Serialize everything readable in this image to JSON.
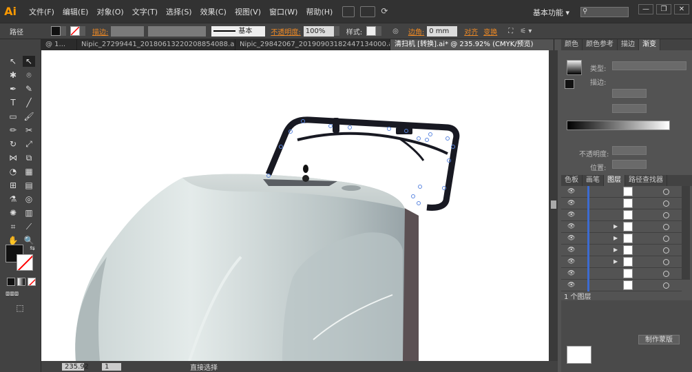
{
  "app": {
    "logo": "Ai"
  },
  "menu": [
    "文件(F)",
    "编辑(E)",
    "对象(O)",
    "文字(T)",
    "选择(S)",
    "效果(C)",
    "视图(V)",
    "窗口(W)",
    "帮助(H)"
  ],
  "workspace_label": "基本功能",
  "window_buttons": [
    "—",
    "❐",
    "✕"
  ],
  "control": {
    "path_label": "路径",
    "stroke_label": "描边:",
    "stroke_style": "基本",
    "opacity_label": "不透明度:",
    "opacity_value": "100%",
    "style_label": "样式:",
    "corner_label": "边角:",
    "corner_value": "0 mm",
    "align_label": "对齐",
    "transform_label": "变换"
  },
  "tabs": [
    {
      "label": "@ 1..."
    },
    {
      "label": "Nipic_27299441_20180613220208854088.ai*"
    },
    {
      "label": "Nipic_29842067_20190903182447134000.ai*"
    },
    {
      "label": "清扫机 [转换].ai* @ 235.92% (CMYK/预览)",
      "active": true
    }
  ],
  "panels": {
    "top_tabs": [
      "颜色",
      "颜色参考",
      "描边",
      "渐变"
    ],
    "gradient": {
      "type_label": "类型:",
      "stroke_label": "描边:",
      "opacity_label": "不透明度:",
      "position_label": "位置:"
    },
    "layer_tabs": [
      "色板",
      "画笔",
      "图层",
      "路径查找器"
    ],
    "layer_rows": 9,
    "layer_count": "1 个图层",
    "bottom_label": "制作蒙版"
  },
  "status": {
    "zoom": "235.92",
    "page": "1",
    "mode": "直接选择"
  },
  "colors": {
    "accent": "#ff9a00",
    "highlight_text": "#f08a24",
    "layer_bar": "#3c6bd1"
  }
}
